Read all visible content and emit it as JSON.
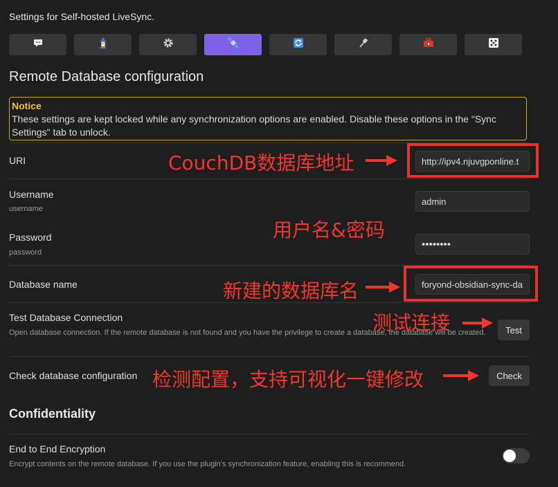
{
  "window": {
    "title": "Settings for Self-hosted LiveSync."
  },
  "tabs": [
    {
      "icon": "speech-bubble-icon",
      "active": false
    },
    {
      "icon": "wizard-icon",
      "active": false
    },
    {
      "icon": "gear-icon",
      "active": false
    },
    {
      "icon": "satellite-icon",
      "active": true
    },
    {
      "icon": "sync-arrows-icon",
      "active": false
    },
    {
      "icon": "plug-icon",
      "active": false
    },
    {
      "icon": "toolbox-icon",
      "active": false
    },
    {
      "icon": "dice-icon",
      "active": false
    }
  ],
  "section_title": "Remote Database configuration",
  "notice": {
    "title": "Notice",
    "text": "These settings are kept locked while any synchronization options are enabled. Disable these options in the \"Sync Settings\" tab to unlock."
  },
  "fields": {
    "uri": {
      "label": "URI",
      "value": "http://ipv4.njuvgponline.t"
    },
    "username": {
      "label": "Username",
      "desc": "username",
      "value": "admin"
    },
    "password": {
      "label": "Password",
      "desc": "password",
      "value": "••••••••"
    },
    "dbname": {
      "label": "Database name",
      "value": "foryond-obsidian-sync-da"
    }
  },
  "test": {
    "label": "Test Database Connection",
    "desc": "Open database connection. If the remote database is not found and you have the privilege to create a database, the database will be created.",
    "button": "Test"
  },
  "check": {
    "label": "Check database configuration",
    "button": "Check"
  },
  "confidentiality": {
    "title": "Confidentiality",
    "e2e_label": "End to End Encryption",
    "e2e_desc": "Encrypt contents on the remote database. If you use the plugin's synchronization feature, enabling this is recommend.",
    "e2e_enabled": false
  },
  "annotations": {
    "uri": "CouchDB数据库地址",
    "credentials": "用户名&密码",
    "dbname": "新建的数据库名",
    "test": "测试连接",
    "check": "检测配置，支持可视化一键修改"
  },
  "colors": {
    "accent": "#7d62e8",
    "annotation": "#f0362f",
    "notice_border": "#c8a81f"
  }
}
